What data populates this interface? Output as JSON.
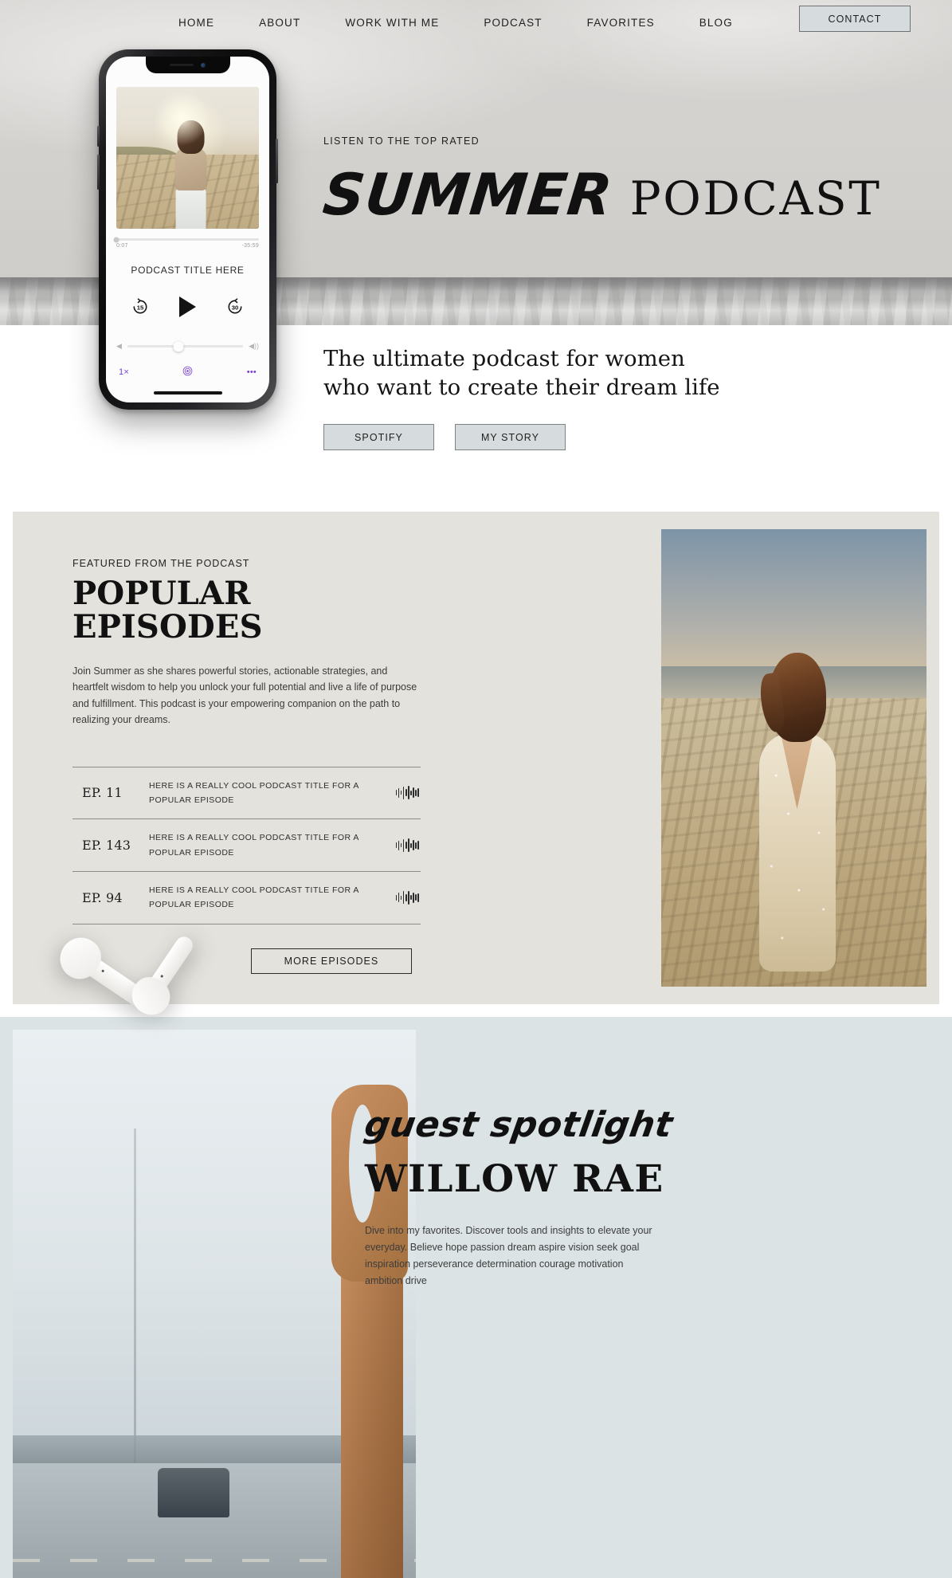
{
  "nav": {
    "links": [
      {
        "label": "HOME"
      },
      {
        "label": "ABOUT"
      },
      {
        "label": "WORK WITH ME"
      },
      {
        "label": "PODCAST"
      },
      {
        "label": "FAVORITES"
      },
      {
        "label": "BLOG"
      }
    ],
    "contact_label": "CONTACT"
  },
  "hero": {
    "kicker": "LISTEN TO THE TOP RATED",
    "title_script": "SUMMER",
    "title_serif": "PODCAST",
    "tagline_line1": "The ultimate podcast for women",
    "tagline_line2": "who want to create their dream life",
    "buttons": [
      {
        "label": "SPOTIFY"
      },
      {
        "label": "MY STORY"
      }
    ]
  },
  "phone": {
    "track_title": "PODCAST TITLE HERE",
    "time_elapsed": "0:07",
    "time_remaining": "-35:59",
    "skip_back_label": "15",
    "skip_forward_label": "30",
    "speed_label": "1×",
    "more_label": "•••"
  },
  "episodes": {
    "kicker": "FEATURED FROM THE PODCAST",
    "heading": "POPULAR EPISODES",
    "body": "Join Summer as she shares powerful stories, actionable strategies, and heartfelt wisdom to help you unlock your full potential and live a life of purpose and fulfillment. This podcast is your empowering companion on the path to realizing your dreams.",
    "items": [
      {
        "number": "EP. 11",
        "title": "HERE IS A REALLY COOL PODCAST TITLE FOR A POPULAR EPISODE"
      },
      {
        "number": "EP. 143",
        "title": "HERE IS A REALLY COOL PODCAST TITLE FOR A POPULAR EPISODE"
      },
      {
        "number": "EP. 94",
        "title": "HERE IS A REALLY COOL PODCAST TITLE FOR A POPULAR EPISODE"
      }
    ],
    "more_label": "MORE EPISODES"
  },
  "guest": {
    "script_label": "guest spotlight",
    "name": "WILLOW RAE",
    "body": "Dive into my favorites. Discover tools and insights to elevate your everyday. Believe hope passion dream aspire vision seek goal inspiration perseverance determination courage motivation ambition drive"
  },
  "colors": {
    "hero_bg": "#d4d2cf",
    "button_fill": "#d6dcdd",
    "episodes_bg": "#e4e2dd",
    "guest_bg": "#dbe3e5",
    "accent_purple": "#7b3fd4"
  }
}
